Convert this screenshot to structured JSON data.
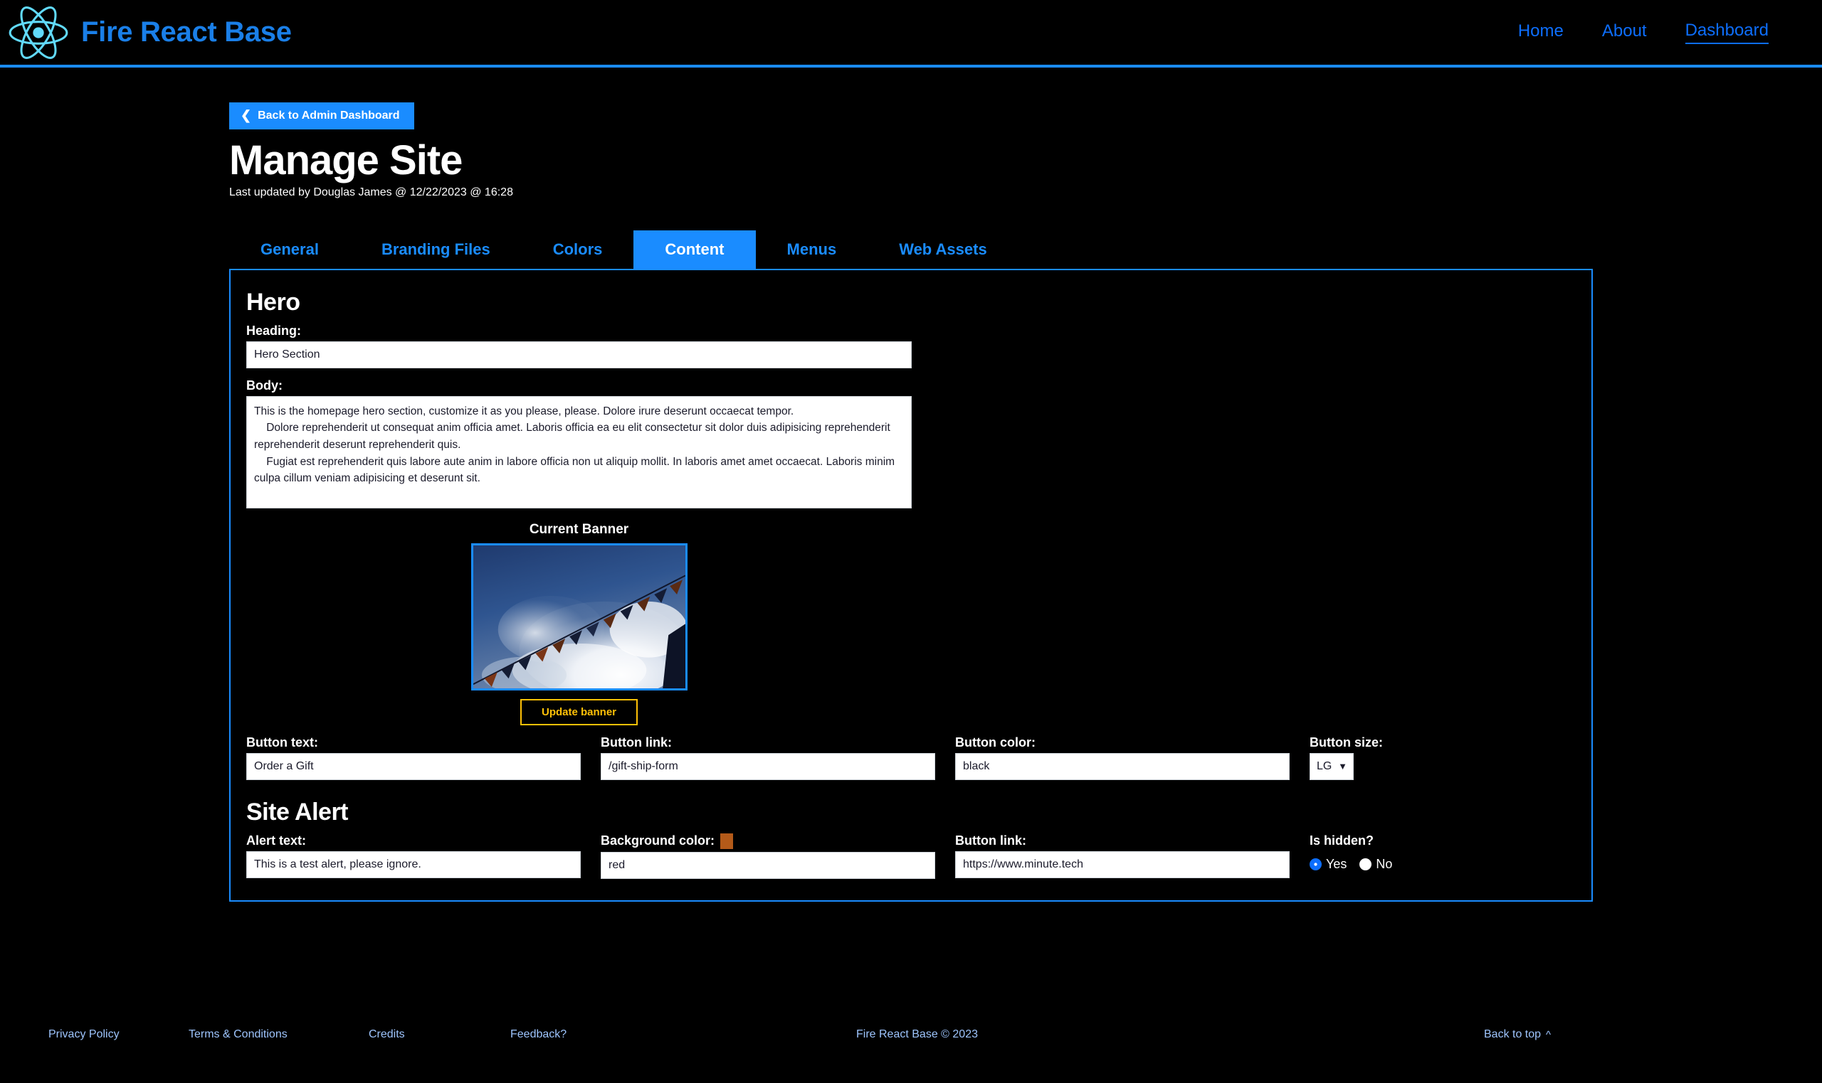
{
  "header": {
    "brand_name": "Fire React Base",
    "logo_icon": "react-atom-icon",
    "nav": [
      {
        "label": "Home",
        "active": false
      },
      {
        "label": "About",
        "active": false
      },
      {
        "label": "Dashboard",
        "active": true
      }
    ]
  },
  "page": {
    "back_button": "Back to Admin Dashboard",
    "back_icon": "chevron-left-icon",
    "title": "Manage Site",
    "subtitle": "Last updated by Douglas James @ 12/22/2023 @ 16:28"
  },
  "tabs": [
    {
      "label": "General",
      "active": false
    },
    {
      "label": "Branding Files",
      "active": false
    },
    {
      "label": "Colors",
      "active": false
    },
    {
      "label": "Content",
      "active": true
    },
    {
      "label": "Menus",
      "active": false
    },
    {
      "label": "Web Assets",
      "active": false
    }
  ],
  "hero": {
    "section_title": "Hero",
    "heading_label": "Heading:",
    "heading_value": "Hero Section",
    "body_label": "Body:",
    "body_value": "This is the homepage hero section, customize it as you please, please. Dolore irure deserunt occaecat tempor.\n    Dolore reprehenderit ut consequat anim officia amet. Laboris officia ea eu elit consectetur sit dolor duis adipisicing reprehenderit reprehenderit deserunt reprehenderit quis.\n    Fugiat est reprehenderit quis labore aute anim in labore officia non ut aliquip mollit. In laboris amet amet occaecat. Laboris minim culpa cillum veniam adipisicing et deserunt sit.",
    "banner_caption": "Current Banner",
    "banner_alt": "sky-with-bunting-flags-image",
    "update_banner_label": "Update banner",
    "button_text_label": "Button text:",
    "button_text_value": "Order a Gift",
    "button_link_label": "Button link:",
    "button_link_value": "/gift-ship-form",
    "button_color_label": "Button color:",
    "button_color_value": "black",
    "button_size_label": "Button size:",
    "button_size_value": "LG",
    "button_size_options": [
      "LG"
    ]
  },
  "site_alert": {
    "section_title": "Site Alert",
    "alert_text_label": "Alert text:",
    "alert_text_value": "This is a test alert, please ignore.",
    "background_color_label": "Background color:",
    "background_color_value": "red",
    "background_color_swatch": "#b35a19",
    "button_link_label": "Button link:",
    "button_link_value": "https://www.minute.tech",
    "is_hidden_label": "Is hidden?",
    "is_hidden_yes": "Yes",
    "is_hidden_no": "No",
    "is_hidden_selected": "Yes"
  },
  "footer": {
    "privacy": "Privacy Policy",
    "terms": "Terms & Conditions",
    "credits": "Credits",
    "feedback": "Feedback?",
    "copyright": "Fire React Base © 2023",
    "back_to_top": "Back to top",
    "back_to_top_icon": "chevron-up-icon"
  },
  "colors": {
    "accent_blue": "#1a8cff",
    "link_blue": "#0d6efd",
    "logo_blue": "#61dafb",
    "brand_text_blue": "#1a7fe8",
    "warning_yellow": "#ffc107",
    "footer_link_blue": "#9ec5fe",
    "background": "#000000"
  }
}
